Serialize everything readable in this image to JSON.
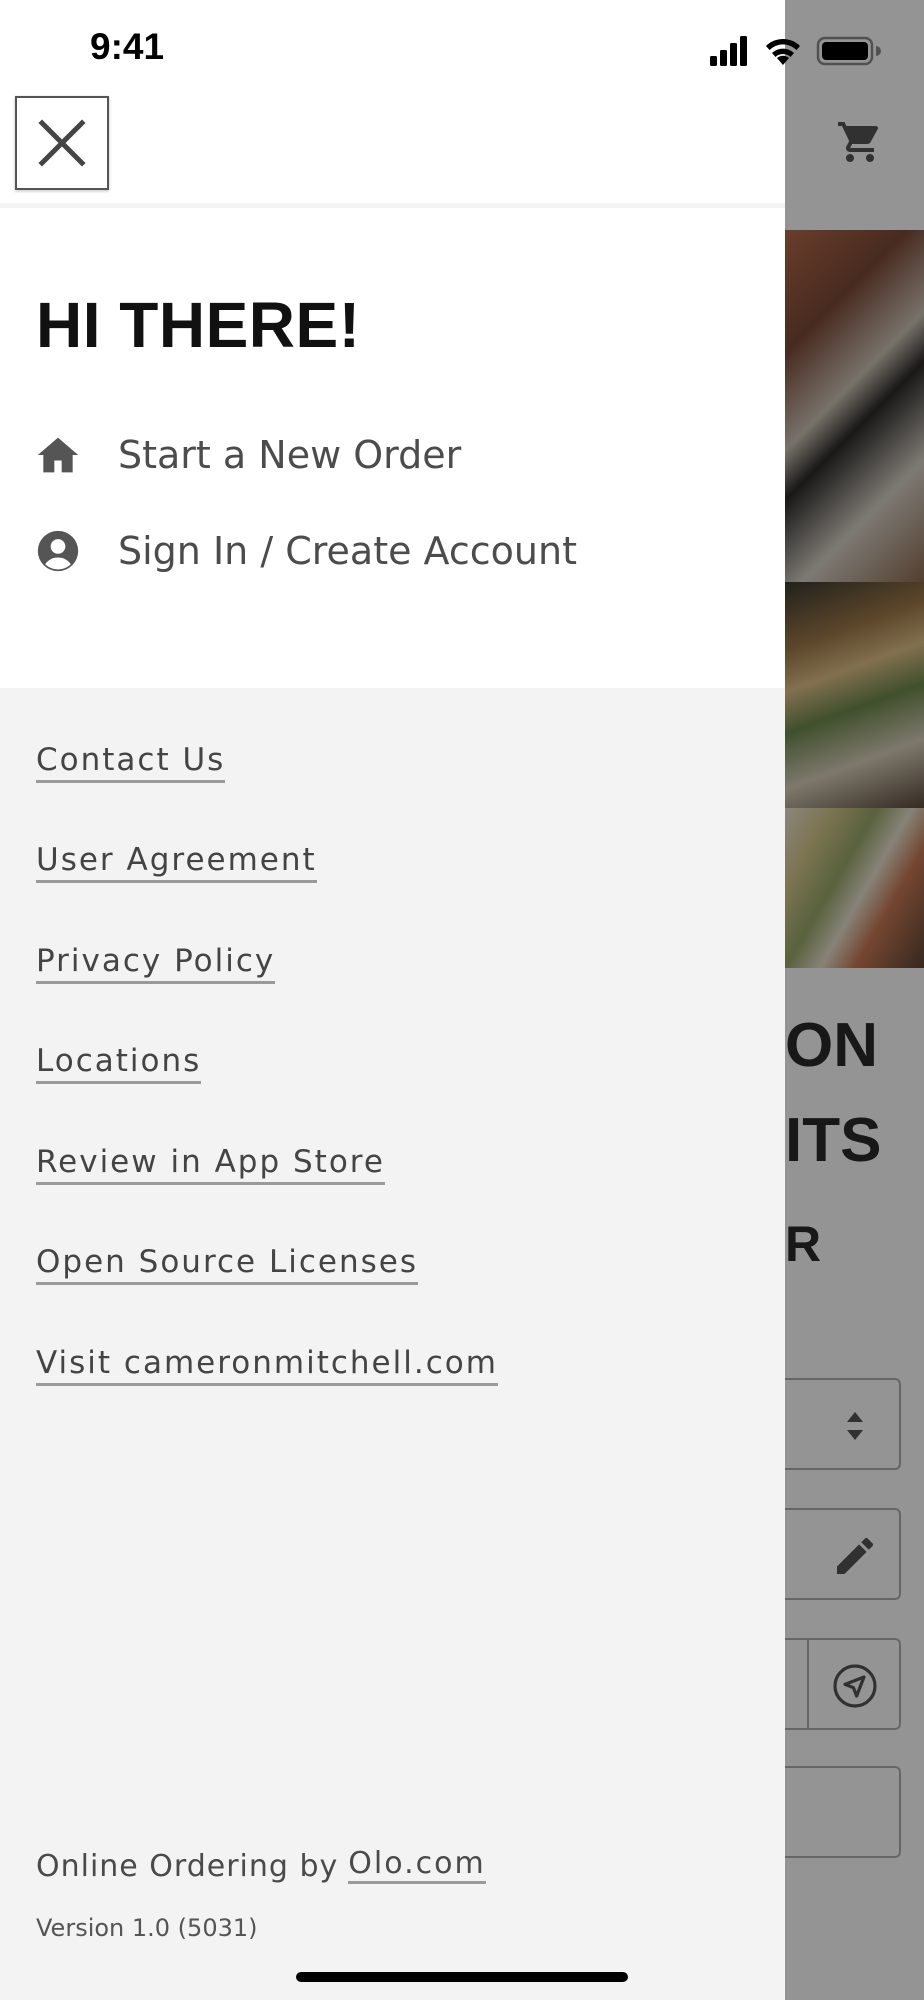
{
  "status_bar": {
    "time": "9:41",
    "icons": [
      "signal-icon",
      "wifi-icon",
      "battery-icon"
    ]
  },
  "background": {
    "cart_icon": "cart-icon",
    "heading_lines": [
      "ON",
      "ITS",
      "R"
    ],
    "field_icons": [
      "select-arrows-icon",
      "pencil-icon",
      "location-arrow-icon"
    ]
  },
  "drawer": {
    "close_icon": "close-icon",
    "greeting": "HI THERE!",
    "menu": [
      {
        "label": "Start a New Order",
        "icon": "home-icon"
      },
      {
        "label": "Sign In / Create Account",
        "icon": "user-circle-icon"
      }
    ],
    "links": [
      "Contact Us",
      "User Agreement",
      "Privacy Policy",
      "Locations",
      "Review in App Store",
      "Open Source Licenses",
      "Visit cameronmitchell.com"
    ],
    "footer": {
      "powered_text": "Online Ordering by",
      "powered_link": "Olo.com",
      "version": "Version 1.0 (5031)"
    }
  },
  "colors": {
    "drawer_top": "#ffffff",
    "drawer_bottom": "#f3f3f3",
    "text_dark": "#111111",
    "text_muted": "#4c4c4c",
    "link_underline": "#9a9a9a",
    "overlay": "rgba(0,0,0,0.42)"
  }
}
